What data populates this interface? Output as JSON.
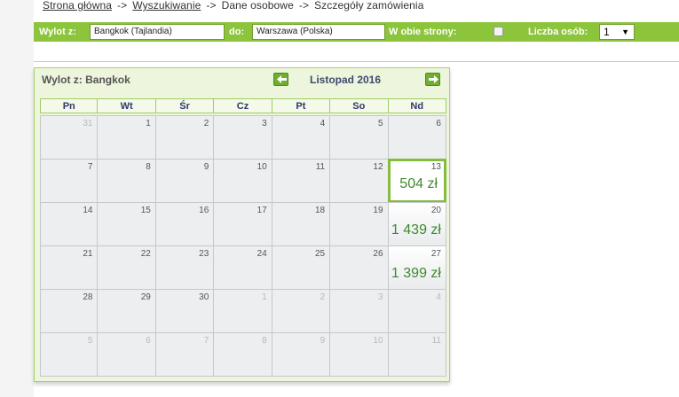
{
  "breadcrumb": {
    "home": "Strona główna",
    "search": "Wyszukiwanie",
    "personal": "Dane osobowe",
    "details": "Szczegóły zamówienia",
    "separator": "->"
  },
  "search_bar": {
    "from_label": "Wylot z:",
    "from_value": "Bangkok (Tajlandia)",
    "to_label": "do:",
    "to_value": "Warszawa (Polska)",
    "roundtrip_label": "W obie strony:",
    "roundtrip_checked": false,
    "persons_label": "Liczba osób:",
    "persons_value": "1"
  },
  "calendar": {
    "from_title": "Wylot z: Bangkok",
    "month": "Listopad 2016",
    "weekdays": [
      "Pn",
      "Wt",
      "Śr",
      "Cz",
      "Pt",
      "So",
      "Nd"
    ],
    "weeks": [
      [
        {
          "day": "31",
          "other": true
        },
        {
          "day": "1"
        },
        {
          "day": "2"
        },
        {
          "day": "3"
        },
        {
          "day": "4"
        },
        {
          "day": "5"
        },
        {
          "day": "6"
        }
      ],
      [
        {
          "day": "7"
        },
        {
          "day": "8"
        },
        {
          "day": "9"
        },
        {
          "day": "10"
        },
        {
          "day": "11"
        },
        {
          "day": "12"
        },
        {
          "day": "13",
          "price": "504 zł",
          "selected": true
        }
      ],
      [
        {
          "day": "14"
        },
        {
          "day": "15"
        },
        {
          "day": "16"
        },
        {
          "day": "17"
        },
        {
          "day": "18"
        },
        {
          "day": "19"
        },
        {
          "day": "20",
          "price": "1 439 zł"
        }
      ],
      [
        {
          "day": "21"
        },
        {
          "day": "22"
        },
        {
          "day": "23"
        },
        {
          "day": "24"
        },
        {
          "day": "25"
        },
        {
          "day": "26"
        },
        {
          "day": "27",
          "price": "1 399 zł"
        }
      ],
      [
        {
          "day": "28"
        },
        {
          "day": "29"
        },
        {
          "day": "30"
        },
        {
          "day": "1",
          "other": true
        },
        {
          "day": "2",
          "other": true
        },
        {
          "day": "3",
          "other": true
        },
        {
          "day": "4",
          "other": true
        }
      ],
      [
        {
          "day": "5",
          "other": true
        },
        {
          "day": "6",
          "other": true
        },
        {
          "day": "7",
          "other": true
        },
        {
          "day": "8",
          "other": true
        },
        {
          "day": "9",
          "other": true
        },
        {
          "day": "10",
          "other": true
        },
        {
          "day": "11",
          "other": true
        }
      ]
    ]
  }
}
